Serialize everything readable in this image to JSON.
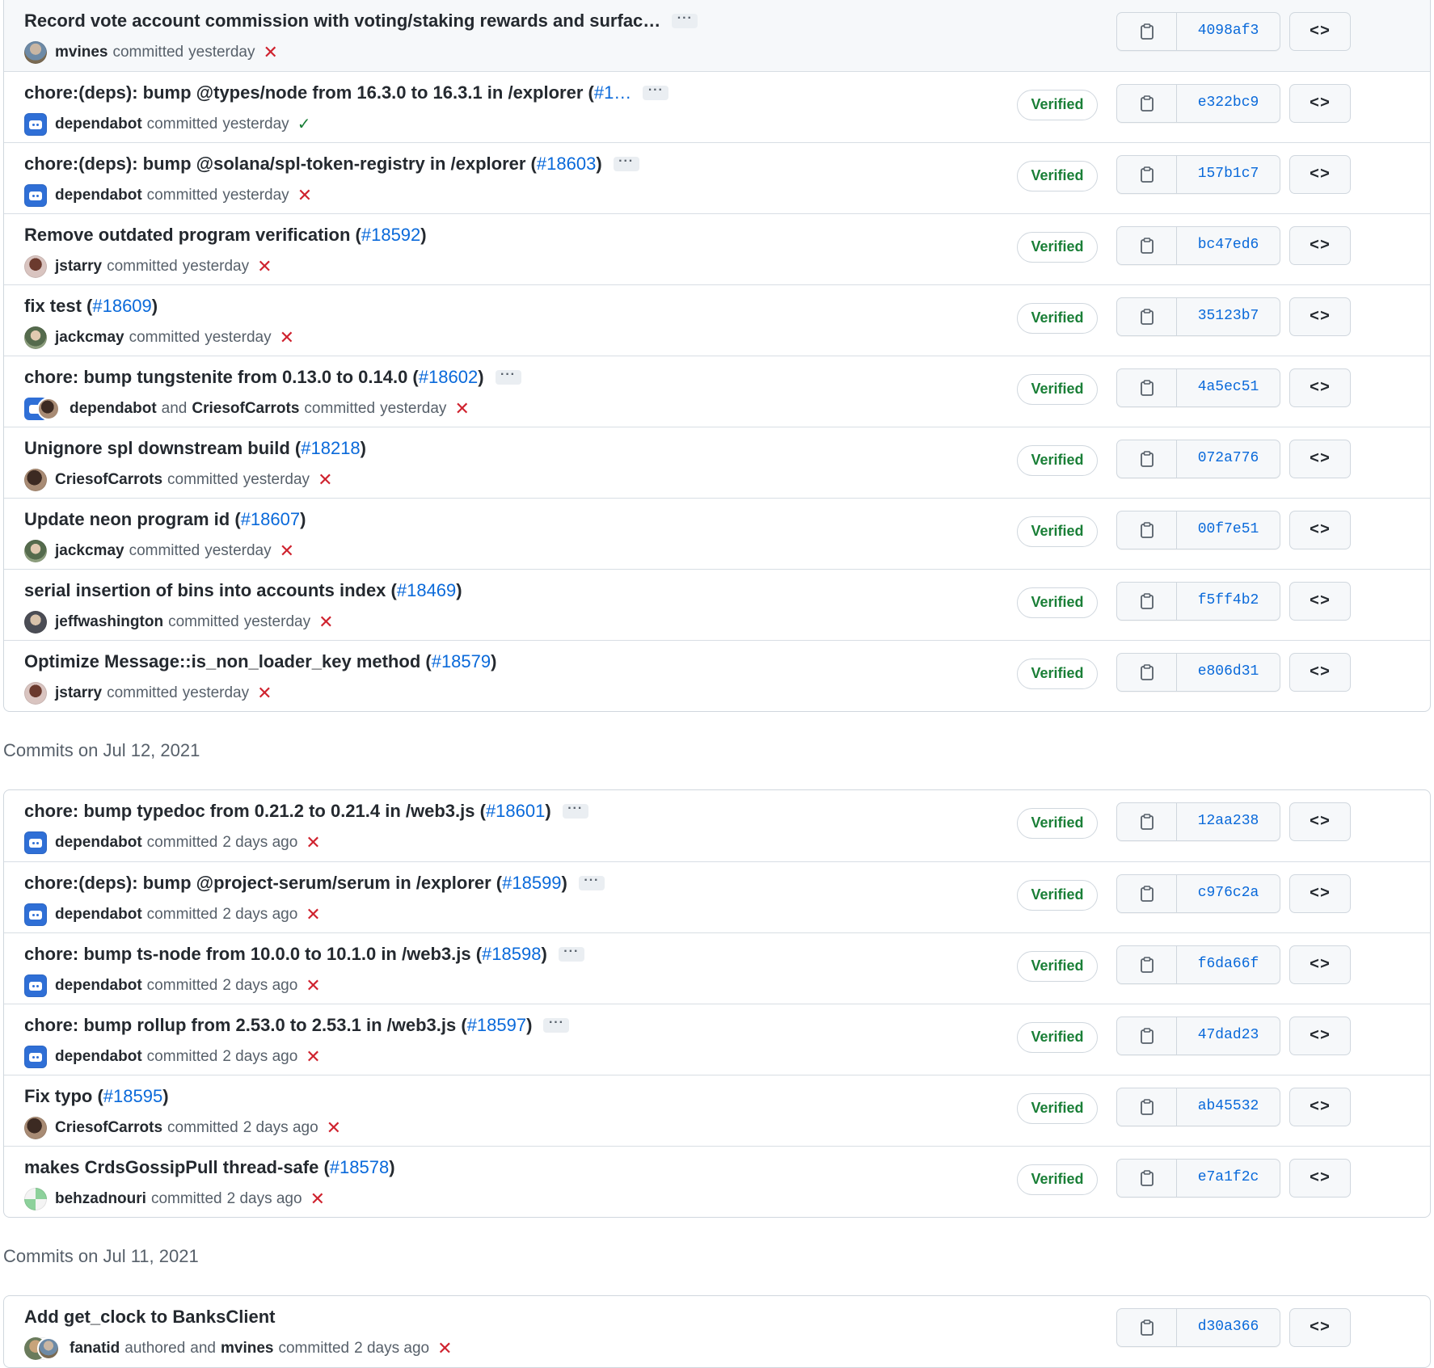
{
  "icons": {
    "copy": "clipboard-icon",
    "browse": "code-icon",
    "more": "ellipsis-icon",
    "fail": "x-icon",
    "pass": "check-icon",
    "bot": "dependabot-icon"
  },
  "colors": {
    "link": "#0969da",
    "verified": "#1a7f37",
    "fail": "#cf222e",
    "pass": "#1a7f37",
    "border": "#d0d7de",
    "muted": "#57606a"
  },
  "labels": {
    "committed": "committed",
    "authored": "authored",
    "and": "and",
    "verified": "Verified",
    "ellipsis": "···",
    "browse": "<>"
  },
  "groups": [
    {
      "header": "",
      "commits": [
        {
          "title": "Record vote account commission with voting/staking rewards and surfac…",
          "pr": "",
          "pr_suffix": "",
          "ellipsis": true,
          "author": "mvines",
          "author_type": "mvines",
          "coauthor": "",
          "time": "yesterday",
          "status": "fail",
          "verified": false,
          "sha": "4098af3",
          "highlight": true
        },
        {
          "title": "chore:(deps): bump @types/node from 16.3.0 to 16.3.1 in /explorer (",
          "pr": "#1…",
          "pr_suffix": "",
          "ellipsis": true,
          "author": "dependabot",
          "author_type": "bot",
          "coauthor": "",
          "time": "yesterday",
          "status": "pass",
          "verified": true,
          "sha": "e322bc9"
        },
        {
          "title": "chore:(deps): bump @solana/spl-token-registry in /explorer (",
          "pr": "#18603",
          "pr_suffix": ")",
          "ellipsis": true,
          "author": "dependabot",
          "author_type": "bot",
          "coauthor": "",
          "time": "yesterday",
          "status": "fail",
          "verified": true,
          "sha": "157b1c7"
        },
        {
          "title": "Remove outdated program verification (",
          "pr": "#18592",
          "pr_suffix": ")",
          "ellipsis": false,
          "author": "jstarry",
          "author_type": "jstarry",
          "coauthor": "",
          "time": "yesterday",
          "status": "fail",
          "verified": true,
          "sha": "bc47ed6"
        },
        {
          "title": "fix test (",
          "pr": "#18609",
          "pr_suffix": ")",
          "ellipsis": false,
          "author": "jackcmay",
          "author_type": "jackcmay",
          "coauthor": "",
          "time": "yesterday",
          "status": "fail",
          "verified": true,
          "sha": "35123b7"
        },
        {
          "title": "chore: bump tungstenite from 0.13.0 to 0.14.0 (",
          "pr": "#18602",
          "pr_suffix": ")",
          "ellipsis": true,
          "author": "dependabot",
          "author_type": "botpair",
          "coauthor": "CriesofCarrots",
          "time": "yesterday",
          "status": "fail",
          "verified": true,
          "sha": "4a5ec51"
        },
        {
          "title": "Unignore spl downstream build (",
          "pr": "#18218",
          "pr_suffix": ")",
          "ellipsis": false,
          "author": "CriesofCarrots",
          "author_type": "carrots",
          "coauthor": "",
          "time": "yesterday",
          "status": "fail",
          "verified": true,
          "sha": "072a776"
        },
        {
          "title": "Update neon program id (",
          "pr": "#18607",
          "pr_suffix": ")",
          "ellipsis": false,
          "author": "jackcmay",
          "author_type": "jackcmay",
          "coauthor": "",
          "time": "yesterday",
          "status": "fail",
          "verified": true,
          "sha": "00f7e51"
        },
        {
          "title": "serial insertion of bins into accounts index (",
          "pr": "#18469",
          "pr_suffix": ")",
          "ellipsis": false,
          "author": "jeffwashington",
          "author_type": "jeff",
          "coauthor": "",
          "time": "yesterday",
          "status": "fail",
          "verified": true,
          "sha": "f5ff4b2"
        },
        {
          "title": "Optimize Message::is_non_loader_key method (",
          "pr": "#18579",
          "pr_suffix": ")",
          "ellipsis": false,
          "author": "jstarry",
          "author_type": "jstarry",
          "coauthor": "",
          "time": "yesterday",
          "status": "fail",
          "verified": true,
          "sha": "e806d31"
        }
      ]
    },
    {
      "header": "Commits on Jul 12, 2021",
      "commits": [
        {
          "title": "chore: bump typedoc from 0.21.2 to 0.21.4 in /web3.js (",
          "pr": "#18601",
          "pr_suffix": ")",
          "ellipsis": true,
          "author": "dependabot",
          "author_type": "bot",
          "coauthor": "",
          "time": "2 days ago",
          "status": "fail",
          "verified": true,
          "sha": "12aa238"
        },
        {
          "title": "chore:(deps): bump @project-serum/serum in /explorer (",
          "pr": "#18599",
          "pr_suffix": ")",
          "ellipsis": true,
          "author": "dependabot",
          "author_type": "bot",
          "coauthor": "",
          "time": "2 days ago",
          "status": "fail",
          "verified": true,
          "sha": "c976c2a"
        },
        {
          "title": "chore: bump ts-node from 10.0.0 to 10.1.0 in /web3.js (",
          "pr": "#18598",
          "pr_suffix": ")",
          "ellipsis": true,
          "author": "dependabot",
          "author_type": "bot",
          "coauthor": "",
          "time": "2 days ago",
          "status": "fail",
          "verified": true,
          "sha": "f6da66f"
        },
        {
          "title": "chore: bump rollup from 2.53.0 to 2.53.1 in /web3.js (",
          "pr": "#18597",
          "pr_suffix": ")",
          "ellipsis": true,
          "author": "dependabot",
          "author_type": "bot",
          "coauthor": "",
          "time": "2 days ago",
          "status": "fail",
          "verified": true,
          "sha": "47dad23"
        },
        {
          "title": "Fix typo (",
          "pr": "#18595",
          "pr_suffix": ")",
          "ellipsis": false,
          "author": "CriesofCarrots",
          "author_type": "carrots",
          "coauthor": "",
          "time": "2 days ago",
          "status": "fail",
          "verified": true,
          "sha": "ab45532"
        },
        {
          "title": "makes CrdsGossipPull thread-safe (",
          "pr": "#18578",
          "pr_suffix": ")",
          "ellipsis": false,
          "author": "behzadnouri",
          "author_type": "behzad",
          "coauthor": "",
          "time": "2 days ago",
          "status": "fail",
          "verified": true,
          "sha": "e7a1f2c"
        }
      ]
    },
    {
      "header": "Commits on Jul 11, 2021",
      "commits": [
        {
          "title": "Add get_clock to BanksClient",
          "pr": "",
          "pr_suffix": "",
          "ellipsis": false,
          "author": "fanatid",
          "author_type": "pair",
          "coauthor": "mvines",
          "authored": true,
          "time": "2 days ago",
          "status": "fail",
          "verified": false,
          "sha": "d30a366"
        }
      ]
    }
  ]
}
